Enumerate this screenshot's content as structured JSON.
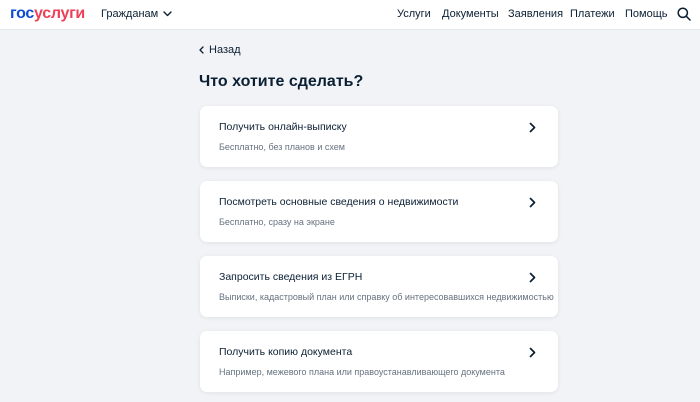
{
  "header": {
    "logo_part1": "гос",
    "logo_part2": "услуги",
    "role_label": "Гражданам",
    "nav": [
      "Услуги",
      "Документы",
      "Заявления",
      "Платежи",
      "Помощь"
    ]
  },
  "back_label": "Назад",
  "page_title": "Что хотите сделать?",
  "options": [
    {
      "title": "Получить онлайн-выписку",
      "subtitle": "Бесплатно, без планов и схем"
    },
    {
      "title": "Посмотреть основные сведения о недвижимости",
      "subtitle": "Бесплатно, сразу на экране"
    },
    {
      "title": "Запросить сведения из ЕГРН",
      "subtitle": "Выписки, кадастровый план или справку об интересовавшихся недвижимостью"
    },
    {
      "title": "Получить копию документа",
      "subtitle": "Например, межевого плана или правоустанавливающего документа"
    }
  ],
  "colors": {
    "brand_blue": "#0d4cd3",
    "brand_red": "#ee3f58",
    "page_bg": "#f1f3f6",
    "text_primary": "#0b1f33",
    "text_secondary": "#66727f"
  },
  "icons": {
    "role_dropdown": "chevron-down-icon",
    "search": "search-icon",
    "back": "chevron-left-icon",
    "card_arrow": "chevron-right-icon"
  }
}
